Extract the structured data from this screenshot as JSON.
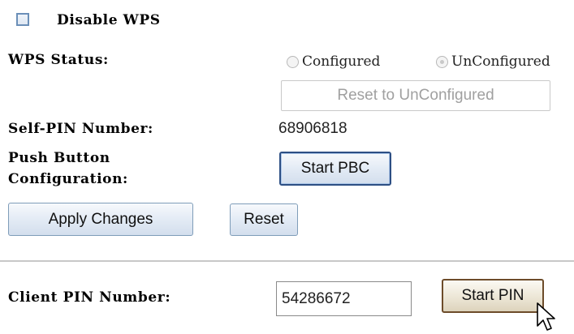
{
  "disable_wps": {
    "label": "Disable WPS",
    "checked": false
  },
  "wps_status": {
    "label": "WPS Status:",
    "options": [
      {
        "label": "Configured",
        "selected": false
      },
      {
        "label": "UnConfigured",
        "selected": true
      }
    ],
    "reset_button": "Reset to UnConfigured"
  },
  "self_pin": {
    "label": "Self-PIN Number:",
    "value": "68906818"
  },
  "pbc": {
    "label_line1": "Push Button",
    "label_line2": "Configuration:",
    "button": "Start PBC"
  },
  "actions": {
    "apply": "Apply Changes",
    "reset": "Reset"
  },
  "client_pin": {
    "label": "Client PIN Number:",
    "value": "54286672",
    "button": "Start PIN"
  },
  "icons": {
    "cursor": "arrow-cursor-icon"
  }
}
